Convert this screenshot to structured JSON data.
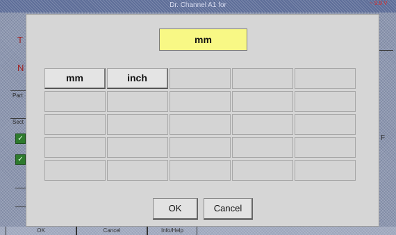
{
  "app": {
    "title": "Dr. Channel A1 for",
    "battery": "~ 9.9 V",
    "side_labels": [
      "T",
      "N",
      "Part",
      "Sect"
    ],
    "right_label": "F",
    "bottom_buttons": [
      "OK",
      "Cancel",
      "Info/Help"
    ]
  },
  "dialog": {
    "display_value": "mm",
    "keys": [
      [
        "mm",
        "inch",
        "",
        "",
        ""
      ],
      [
        "",
        "",
        "",
        "",
        ""
      ],
      [
        "",
        "",
        "",
        "",
        ""
      ],
      [
        "",
        "",
        "",
        "",
        ""
      ],
      [
        "",
        "",
        "",
        "",
        ""
      ]
    ],
    "ok_label": "OK",
    "cancel_label": "Cancel"
  },
  "colors": {
    "display_bg": "#f8f885",
    "dialog_bg": "#d6d6d6",
    "background": "#8d97b0"
  }
}
